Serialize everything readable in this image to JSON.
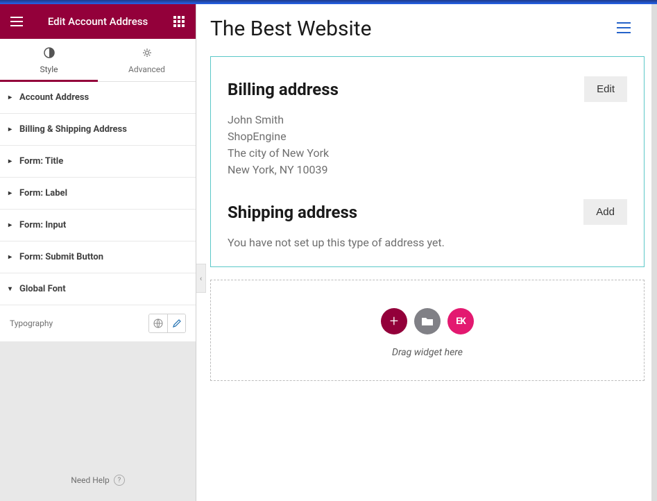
{
  "header": {
    "title": "Edit Account Address"
  },
  "tabs": {
    "style": "Style",
    "advanced": "Advanced"
  },
  "panels": {
    "account_address": "Account Address",
    "billing_shipping": "Billing & Shipping Address",
    "form_title": "Form: Title",
    "form_label": "Form: Label",
    "form_input": "Form: Input",
    "form_submit": "Form: Submit Button",
    "global_font": "Global Font"
  },
  "typography": {
    "label": "Typography"
  },
  "footer": {
    "help": "Need Help"
  },
  "page": {
    "title": "The Best Website"
  },
  "billing": {
    "heading": "Billing address",
    "button": "Edit",
    "line1": "John Smith",
    "line2": "ShopEngine",
    "line3": "The city of New York",
    "line4": "New York, NY 10039"
  },
  "shipping": {
    "heading": "Shipping address",
    "button": "Add",
    "empty": "You have not set up this type of address yet."
  },
  "dropzone": {
    "text": "Drag widget here",
    "ek_label": "EK"
  }
}
